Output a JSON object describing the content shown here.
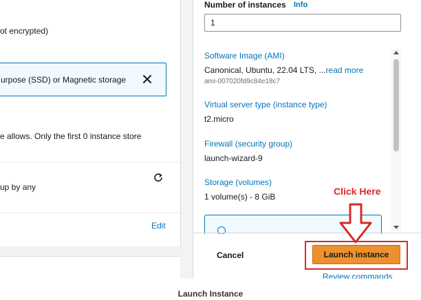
{
  "left": {
    "encryption_text": "ot encrypted)",
    "storage_banner_text": "urpose (SSD) or Magnetic storage",
    "instance_store_text": "e allows. Only the first 0 instance store",
    "backup_text": "up by any",
    "edit_label": "Edit"
  },
  "right": {
    "instances_label": "Number of instances",
    "info_label": "Info",
    "instances_value": "1",
    "summary": {
      "ami_title": "Software Image (AMI)",
      "ami_value": "Canonical, Ubuntu, 22.04 LTS, ...",
      "read_more": "read more",
      "ami_id": "ami-007020fd9c84e18c7",
      "type_title": "Virtual server type (instance type)",
      "type_value": "t2.micro",
      "firewall_title": "Firewall (security group)",
      "firewall_value": "launch-wizard-9",
      "storage_title": "Storage (volumes)",
      "storage_value": "1 volume(s) - 8 GiB"
    },
    "cancel_label": "Cancel",
    "launch_label": "Launch instance",
    "review_label": "Review commands"
  },
  "annotation": {
    "click_here": "Click Here",
    "color": "#d92828"
  },
  "caption": "Launch Instance",
  "colors": {
    "accent_link": "#0073bb",
    "primary_button": "#ec912d"
  },
  "icons": [
    "close-icon",
    "refresh-icon",
    "info-circle-icon",
    "scroll-up-icon",
    "scroll-down-icon",
    "arrow-down-icon"
  ]
}
